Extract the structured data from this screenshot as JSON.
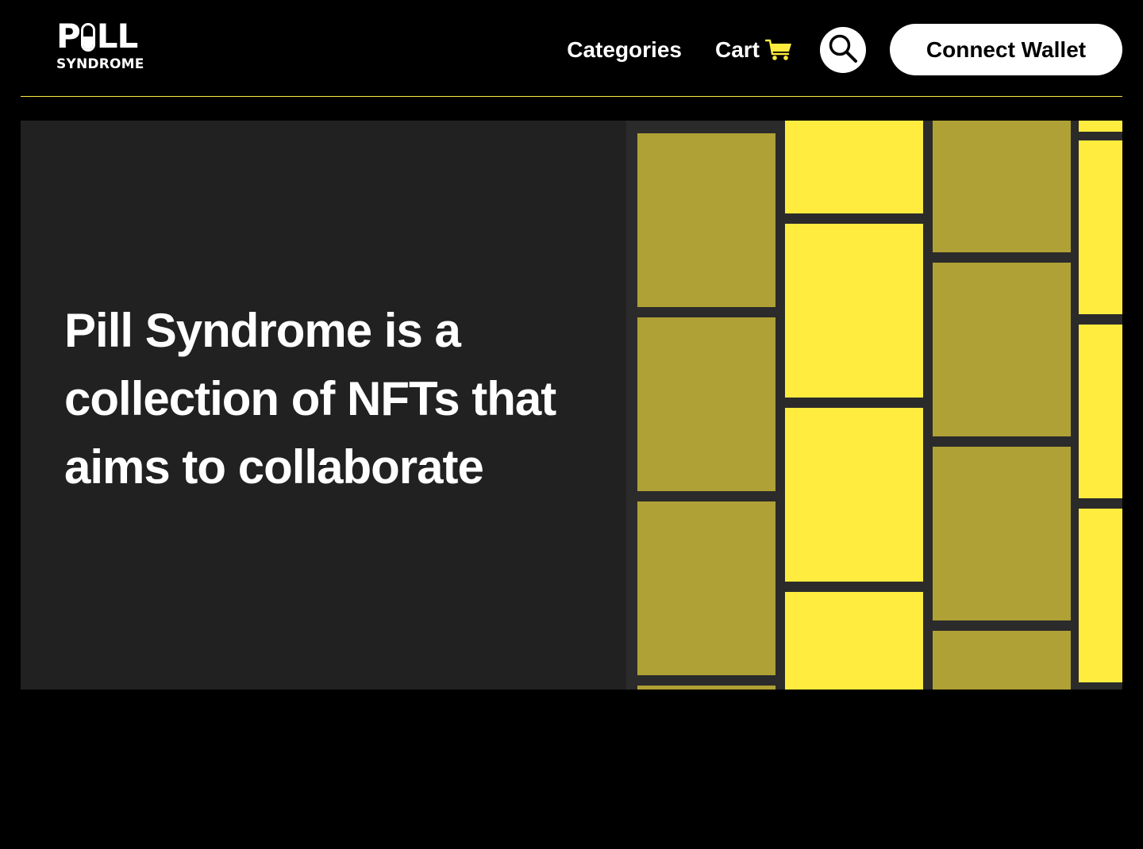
{
  "brand": {
    "logo_top_left": "P",
    "logo_top_right": "LL",
    "logo_bottom": "SYNDROME"
  },
  "nav": {
    "categories": "Categories",
    "cart": "Cart",
    "cart_icon": "cart-icon",
    "search_icon": "search-icon",
    "connect_wallet": "Connect Wallet"
  },
  "hero": {
    "headline": "Pill Syndrome is a collection of NFTs that aims to collaborate"
  },
  "colors": {
    "background": "#000000",
    "panel": "#212121",
    "accent_yellow": "#ffec3e",
    "accent_olive": "#afa135",
    "divider": "#fde93f",
    "text": "#ffffff"
  }
}
